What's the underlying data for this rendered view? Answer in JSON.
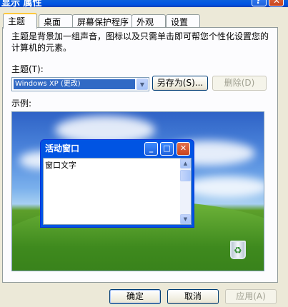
{
  "window": {
    "title": "显示 属性"
  },
  "tabs": [
    "主题",
    "桌面",
    "屏幕保护程序",
    "外观",
    "设置"
  ],
  "description": "主题是背景加一组声音，图标以及只需单击即可帮您个性化设置您的计算机的元素。",
  "theme_label": "主题(T):",
  "theme_value": "Windows XP (更改)",
  "save_as_label": "另存为(S)...",
  "delete_label": "删除(D)",
  "preview_label": "示例:",
  "preview": {
    "window_title": "活动窗口",
    "window_text": "窗口文字"
  },
  "buttons": {
    "ok": "确定",
    "cancel": "取消",
    "apply": "应用(A)"
  }
}
